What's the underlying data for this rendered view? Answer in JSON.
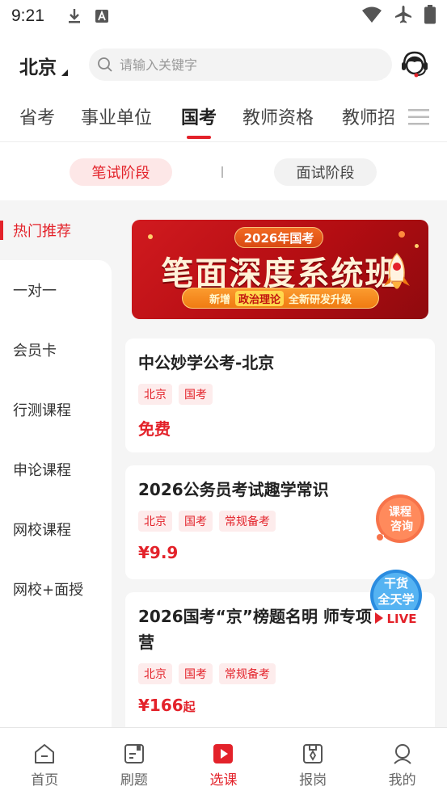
{
  "status_bar": {
    "time": "9:21"
  },
  "header": {
    "city": "北京",
    "search_placeholder": "请输入关键字"
  },
  "tabs": [
    {
      "label": "省考",
      "active": false
    },
    {
      "label": "事业单位",
      "active": false
    },
    {
      "label": "国考",
      "active": true
    },
    {
      "label": "教师资格",
      "active": false
    },
    {
      "label": "教师招",
      "active": false
    }
  ],
  "stage": {
    "written": "笔试阶段",
    "interview": "面试阶段"
  },
  "sidebar": {
    "items": [
      {
        "label": "热门推荐",
        "active": true
      },
      {
        "label": "一对一",
        "active": false
      },
      {
        "label": "会员卡",
        "active": false
      },
      {
        "label": "行测课程",
        "active": false
      },
      {
        "label": "申论课程",
        "active": false
      },
      {
        "label": "网校课程",
        "active": false
      },
      {
        "label": "网校+面授",
        "active": false
      }
    ]
  },
  "banner": {
    "tag": "2026年国考",
    "headline": "笔面深度系统班",
    "sub_prefix": "新增",
    "sub_highlight": "政治理论",
    "sub_suffix": "全新研发升级"
  },
  "courses": [
    {
      "title": "中公妙学公考-北京",
      "tags": [
        "北京",
        "国考"
      ],
      "price": "免费",
      "price_suffix": ""
    },
    {
      "title": "2026公务员考试趣学常识",
      "tags": [
        "北京",
        "国考",
        "常规备考"
      ],
      "price": "¥9.9",
      "price_suffix": ""
    },
    {
      "title_line1": "2026国考“京”榜题名明 师专项",
      "title_line2": "营",
      "tags": [
        "北京",
        "国考",
        "常规备考"
      ],
      "price": "¥166",
      "price_suffix": "起"
    }
  ],
  "floating": {
    "consult_line1": "课程",
    "consult_line2": "咨询",
    "live_line1": "干货",
    "live_line2": "全天学",
    "live_line3": "LIVE"
  },
  "bottom_nav": [
    {
      "label": "首页",
      "icon": "home-icon",
      "active": false
    },
    {
      "label": "刷题",
      "icon": "practice-icon",
      "active": false
    },
    {
      "label": "选课",
      "icon": "course-icon",
      "active": true
    },
    {
      "label": "报岗",
      "icon": "job-icon",
      "active": false
    },
    {
      "label": "我的",
      "icon": "profile-icon",
      "active": false
    }
  ],
  "colors": {
    "accent": "#e3222a",
    "accent_light": "#fdecec",
    "background": "#f5f5f5"
  }
}
